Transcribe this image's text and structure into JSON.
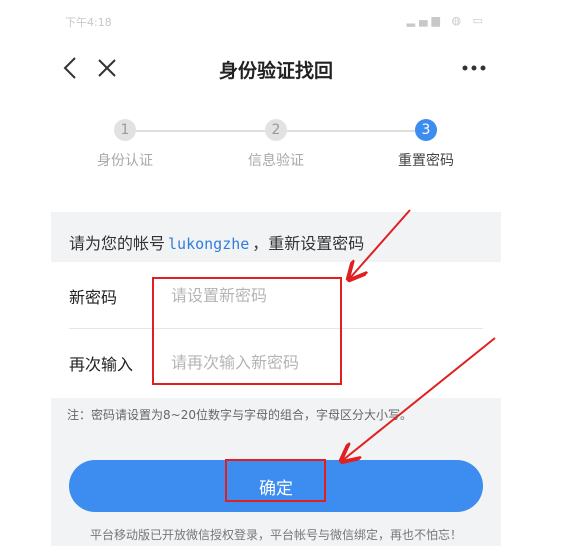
{
  "statusbar": {
    "time": "下午4:18",
    "icons": "▂▄▆ ◍ ▭"
  },
  "nav": {
    "title": "身份验证找回",
    "more": "•••"
  },
  "steps": [
    {
      "number": "1",
      "label": "身份认证",
      "state": "done"
    },
    {
      "number": "2",
      "label": "信息验证",
      "state": "done"
    },
    {
      "number": "3",
      "label": "重置密码",
      "state": "active"
    }
  ],
  "account": {
    "prefix": "请为您的帐号",
    "name": "lukongzhe",
    "suffix": "，重新设置密码"
  },
  "form": {
    "new_password_label": "新密码",
    "new_password_placeholder": "请设置新密码",
    "confirm_label": "再次输入",
    "confirm_placeholder": "请再次输入新密码"
  },
  "note": "注：密码请设置为8~20位数字与字母的组合，字母区分大小写。",
  "confirm_button": "确定",
  "footer": "平台移动版已开放微信授权登录，平台帐号与微信绑定，再也不怕忘！",
  "colors": {
    "accent": "#3d8cf0",
    "link": "#2f7fd9",
    "annotation": "#e02020"
  }
}
